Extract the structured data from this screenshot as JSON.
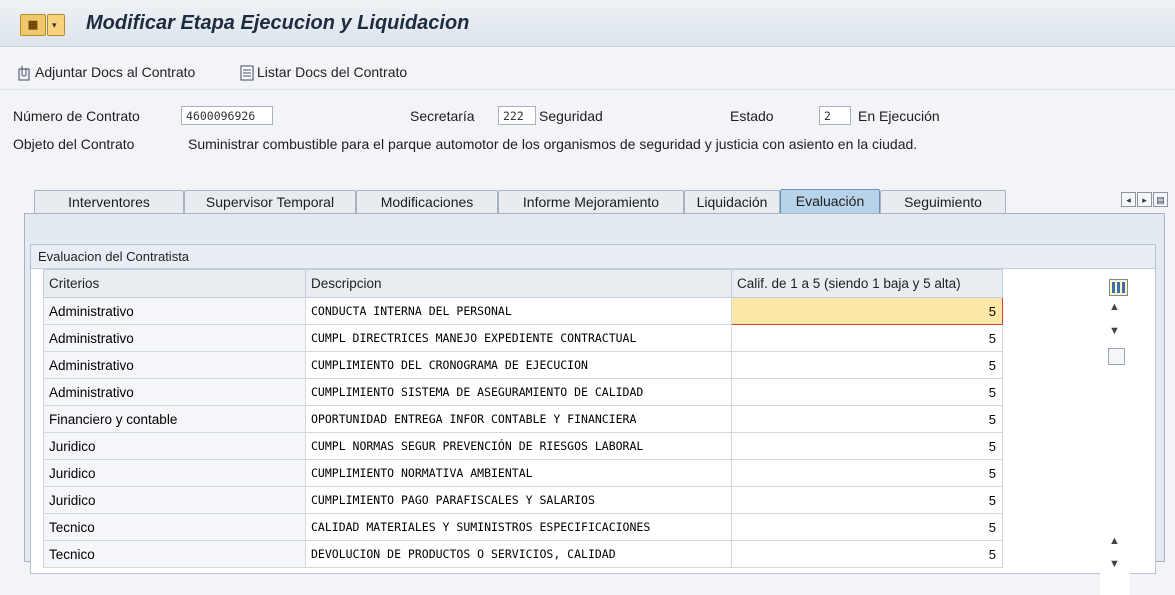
{
  "window": {
    "title": "Modificar Etapa Ejecucion y Liquidacion",
    "icon_name": "sap-menu-icon"
  },
  "toolbar": {
    "attach_label": "Adjuntar Docs al Contrato",
    "list_label": "Listar Docs del Contrato"
  },
  "header": {
    "contract_label": "Número de Contrato",
    "contract_value": "4600096926",
    "secretaria_label": "Secretaría",
    "secretaria_code": "222",
    "secretaria_name": "Seguridad",
    "estado_label": "Estado",
    "estado_code": "2",
    "estado_name": "En Ejecución",
    "objeto_label": "Objeto del Contrato",
    "objeto_value": "Suministrar combustible para el parque automotor de los organismos de seguridad y justicia con asiento en la ciudad."
  },
  "tabs": [
    {
      "label": "Interventores"
    },
    {
      "label": "Supervisor Temporal"
    },
    {
      "label": "Modificaciones"
    },
    {
      "label": "Informe Mejoramiento"
    },
    {
      "label": "Liquidación"
    },
    {
      "label": "Evaluación",
      "active": true
    },
    {
      "label": "Seguimiento"
    }
  ],
  "evaluation": {
    "group_title": "Evaluacion del Contratista",
    "columns": {
      "criterios": "Criterios",
      "descripcion": "Descripcion",
      "calificacion": "Calif. de 1 a 5 (siendo 1 baja y 5 alta)"
    },
    "rows": [
      {
        "criterio": "Administrativo",
        "descripcion": "CONDUCTA INTERNA DEL PERSONAL",
        "calif": "5"
      },
      {
        "criterio": "Administrativo",
        "descripcion": "CUMPL DIRECTRICES MANEJO EXPEDIENTE CONTRACTUAL",
        "calif": "5"
      },
      {
        "criterio": "Administrativo",
        "descripcion": "CUMPLIMIENTO DEL CRONOGRAMA DE EJECUCION",
        "calif": "5"
      },
      {
        "criterio": "Administrativo",
        "descripcion": "CUMPLIMIENTO SISTEMA DE ASEGURAMIENTO DE CALIDAD",
        "calif": "5"
      },
      {
        "criterio": "Financiero y contable",
        "descripcion": "OPORTUNIDAD ENTREGA INFOR CONTABLE Y FINANCIERA",
        "calif": "5"
      },
      {
        "criterio": "Juridico",
        "descripcion": "CUMPL NORMAS SEGUR PREVENCIÓN DE RIESGOS LABORAL",
        "calif": "5"
      },
      {
        "criterio": "Juridico",
        "descripcion": "CUMPLIMIENTO NORMATIVA AMBIENTAL",
        "calif": "5"
      },
      {
        "criterio": "Juridico",
        "descripcion": "CUMPLIMIENTO PAGO PARAFISCALES Y SALARIOS",
        "calif": "5"
      },
      {
        "criterio": "Tecnico",
        "descripcion": "CALIDAD MATERIALES Y SUMINISTROS ESPECIFICACIONES",
        "calif": "5"
      },
      {
        "criterio": "Tecnico",
        "descripcion": "DEVOLUCION DE PRODUCTOS O SERVICIOS, CALIDAD",
        "calif": "5"
      }
    ]
  },
  "colors": {
    "selected_cell": "#fde7a6",
    "active_tab": "#b7d3ea"
  }
}
